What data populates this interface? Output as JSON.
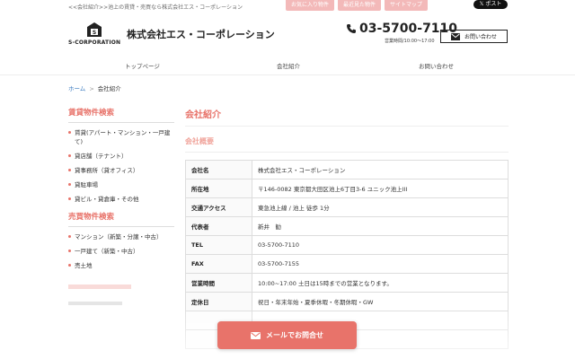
{
  "topbar": {
    "tagline": "<<会社紹介>>池上の賃貸・売買なら株式会社エス・コーポレーション",
    "buttons": [
      "お気に入り物件",
      "最近見た物件",
      "サイトマップ"
    ],
    "xpost": "𝕏 ポスト"
  },
  "header": {
    "logo_text": "S-CORPORATION",
    "company_name": "株式会社エス・コーポレーション",
    "phone": "03-5700-7110",
    "hours": "営業時間/10:00～17:00",
    "inquiry_button": "お問い合わせ"
  },
  "nav": {
    "items": [
      "トップページ",
      "会社紹介",
      "お問い合わせ"
    ]
  },
  "breadcrumb": {
    "home": "ホーム",
    "sep": ">",
    "current": "会社紹介"
  },
  "sidebar": {
    "rental_title": "賃貸物件検索",
    "rental_items": [
      "賃貸(アパート・マンション・一戸建て)",
      "貸店舗（テナント）",
      "貸事務所（貸オフィス）",
      "貸駐車場",
      "貸ビル・貸倉庫・その他"
    ],
    "sale_title": "売買物件検索",
    "sale_items": [
      "マンション（新築・分譲・中古）",
      "一戸建て（新築・中古）",
      "売土地"
    ]
  },
  "main": {
    "title": "会社紹介",
    "subtitle": "会社概要",
    "rows": [
      {
        "key": "会社名",
        "value": "株式会社エス・コーポレーション"
      },
      {
        "key": "所在地",
        "value": "〒146-0082 東京都大田区池上6丁目3-6 ユニック池上III"
      },
      {
        "key": "交通アクセス",
        "value": "東急池上線 / 池上 徒歩 1分"
      },
      {
        "key": "代表者",
        "value": "新井　勧"
      },
      {
        "key": "TEL",
        "value": "03-5700-7110"
      },
      {
        "key": "FAX",
        "value": "03-5700-7155"
      },
      {
        "key": "営業時間",
        "value": "10:00~17:00 土日は15時までの営業となります。"
      },
      {
        "key": "定休日",
        "value": "祝日・年末年始・夏季休暇・冬期休暇・GW"
      }
    ]
  },
  "cta": {
    "label": "メールでお問合せ"
  },
  "colors": {
    "accent": "#e8736a",
    "pink": "#f3b9b9",
    "link": "#3b7bc0"
  }
}
